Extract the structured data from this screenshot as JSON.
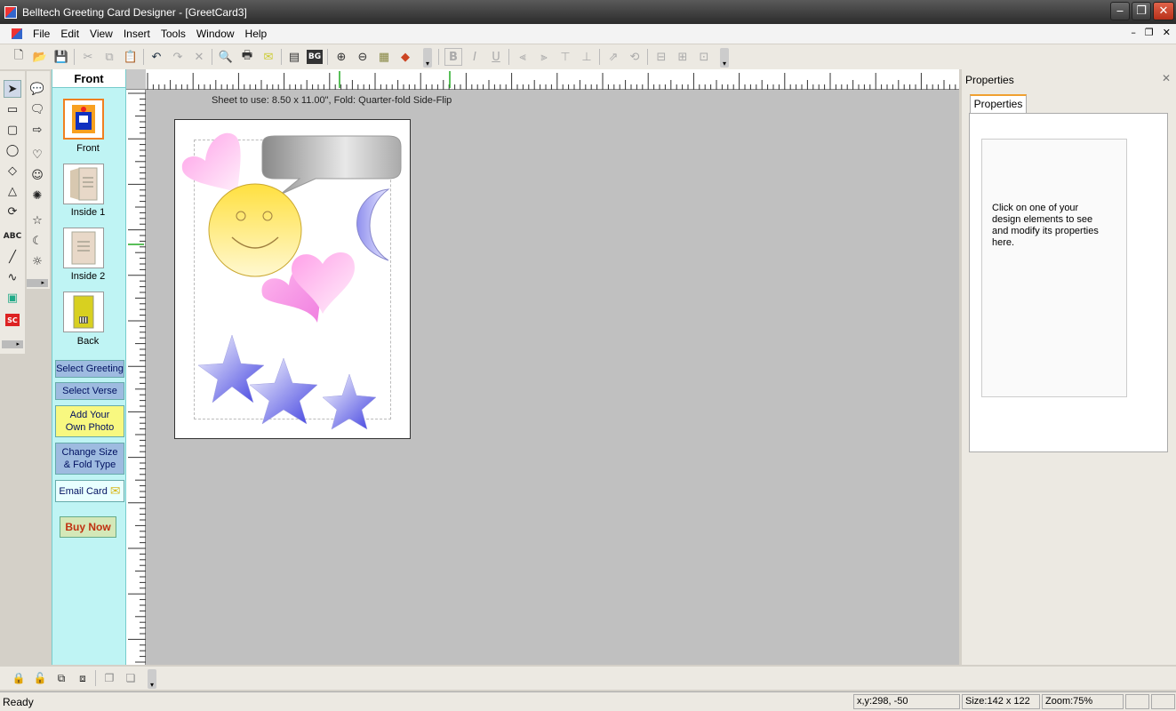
{
  "window": {
    "title": "Belltech Greeting Card Designer  - [GreetCard3]",
    "minimize_glyph": "‒",
    "maximize_glyph": "❐",
    "close_glyph": "✕"
  },
  "menu": {
    "items": [
      "File",
      "Edit",
      "View",
      "Insert",
      "Tools",
      "Window",
      "Help"
    ],
    "mdi_minimize": "–",
    "mdi_restore": "❐",
    "mdi_close": "✕"
  },
  "toolbar": {
    "bg_label": "BG",
    "bold_label": "B",
    "italic_label": "I",
    "underline_label": "U"
  },
  "tools": {
    "text_tool_label": "ABC",
    "clipart_label": "SC"
  },
  "page_panel": {
    "header": "Front",
    "pages": [
      "Front",
      "Inside 1",
      "Inside 2",
      "Back"
    ],
    "buttons": {
      "select_greeting": "Select Greeting",
      "select_verse": "Select Verse",
      "add_photo_line1": "Add Your",
      "add_photo_line2": "Own Photo",
      "change_size_line1": "Change Size",
      "change_size_line2": "& Fold Type",
      "email_card": "Email Card",
      "buy_now": "Buy Now"
    }
  },
  "canvas": {
    "sheet_info": "Sheet to use: 8.50 x 11.00\", Fold: Quarter-fold Side-Flip",
    "background_color": "#c0c0c0"
  },
  "properties": {
    "title": "Properties",
    "close_glyph": "✕",
    "tab": "Properties",
    "message": "Click on one of your design elements to see and modify its properties here."
  },
  "statusbar": {
    "ready": "Ready",
    "coords": "x,y:298, -50",
    "size": "Size:142 x 122",
    "zoom": "Zoom:75%"
  },
  "colors": {
    "page_panel_bg": "#bff4f4",
    "selected_page_border": "#f08020",
    "buy_now_text": "#c03010"
  }
}
